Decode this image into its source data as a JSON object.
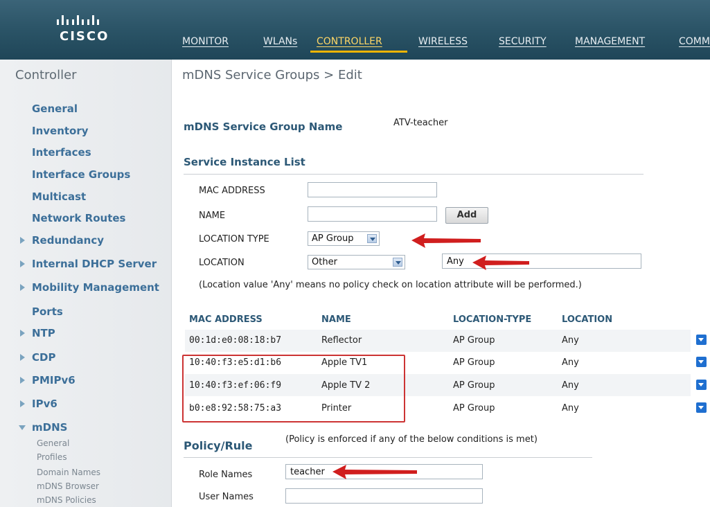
{
  "header": {
    "logo_text": "CISCO",
    "nav": [
      {
        "label": "MONITOR",
        "active": false
      },
      {
        "label": "WLANs",
        "active": false
      },
      {
        "label": "CONTROLLER",
        "active": true
      },
      {
        "label": "WIRELESS",
        "active": false
      },
      {
        "label": "SECURITY",
        "active": false
      },
      {
        "label": "MANAGEMENT",
        "active": false
      },
      {
        "label": "COMM",
        "active": false
      }
    ],
    "colors": {
      "bar": "#2c5568",
      "active_tab": "#f0b400"
    }
  },
  "sidebar": {
    "title": "Controller",
    "items": [
      {
        "label": "General",
        "arrow": "none"
      },
      {
        "label": "Inventory",
        "arrow": "none"
      },
      {
        "label": "Interfaces",
        "arrow": "none"
      },
      {
        "label": "Interface Groups",
        "arrow": "none"
      },
      {
        "label": "Multicast",
        "arrow": "none"
      },
      {
        "label": "Network Routes",
        "arrow": "none"
      },
      {
        "label": "Redundancy",
        "arrow": "right"
      },
      {
        "label": "Internal DHCP Server",
        "arrow": "right"
      },
      {
        "label": "Mobility Management",
        "arrow": "right"
      },
      {
        "label": "Ports",
        "arrow": "none"
      },
      {
        "label": "NTP",
        "arrow": "right"
      },
      {
        "label": "CDP",
        "arrow": "right"
      },
      {
        "label": "PMIPv6",
        "arrow": "right"
      },
      {
        "label": "IPv6",
        "arrow": "right"
      },
      {
        "label": "mDNS",
        "arrow": "down"
      }
    ],
    "mdns_sub": [
      "General",
      "Profiles",
      "Domain Names",
      "mDNS Browser",
      "mDNS Policies"
    ]
  },
  "main": {
    "title": "mDNS Service Groups > Edit",
    "group_name_label": "mDNS Service Group Name",
    "group_name_value": "ATV-teacher",
    "service_instance": {
      "heading": "Service Instance List",
      "mac_label": "MAC ADDRESS",
      "mac_value": "",
      "name_label": "NAME",
      "name_value": "",
      "add_button": "Add",
      "location_type_label": "LOCATION TYPE",
      "location_type_value": "AP Group",
      "location_label": "LOCATION",
      "location_select_value": "Other",
      "location_text_value": "Any",
      "note": "(Location value 'Any' means no policy check on location attribute will be performed.)"
    },
    "table": {
      "headers": [
        "MAC ADDRESS",
        "NAME",
        "LOCATION-TYPE",
        "LOCATION"
      ],
      "rows": [
        [
          "00:1d:e0:08:18:b7",
          "Reflector",
          "AP Group",
          "Any"
        ],
        [
          "10:40:f3:e5:d1:b6",
          "Apple TV1",
          "AP Group",
          "Any"
        ],
        [
          "10:40:f3:ef:06:f9",
          "Apple TV 2",
          "AP Group",
          "Any"
        ],
        [
          "b0:e8:92:58:75:a3",
          "Printer",
          "AP Group",
          "Any"
        ]
      ]
    },
    "policy": {
      "heading": "Policy/Rule",
      "note": "(Policy is enforced if any of the below conditions is met)",
      "role_label": "Role Names",
      "role_value": "teacher",
      "user_label": "User Names",
      "user_value": ""
    }
  },
  "annotation_color": "#d01e1e"
}
